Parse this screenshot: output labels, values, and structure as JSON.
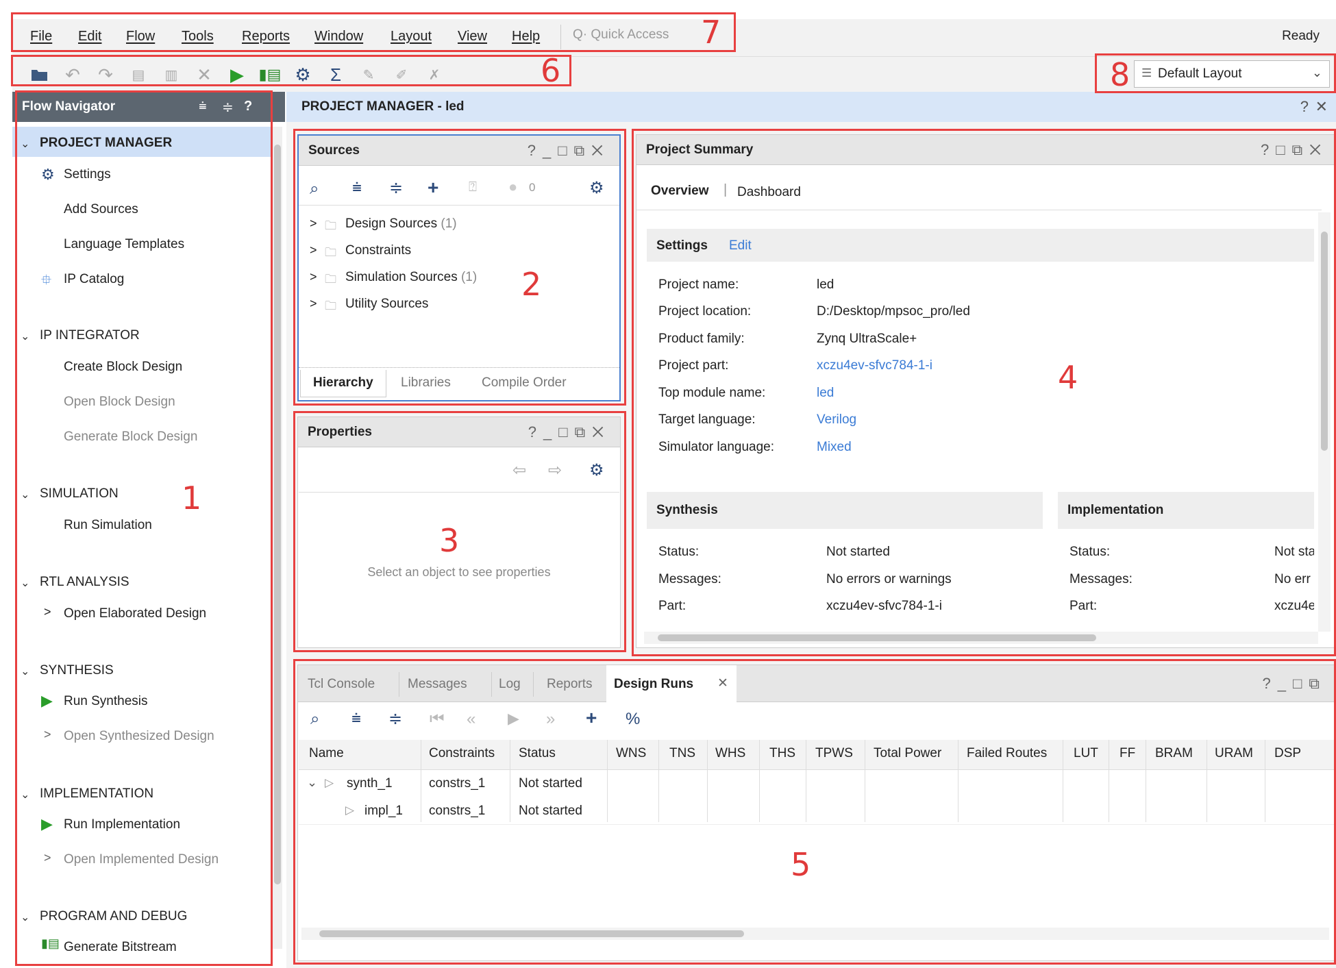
{
  "menubar": {
    "items": [
      "File",
      "Edit",
      "Flow",
      "Tools",
      "Reports",
      "Window",
      "Layout",
      "View",
      "Help"
    ],
    "quick_access": "Quick Access",
    "status": "Ready"
  },
  "layout_select": {
    "value": "Default Layout"
  },
  "annotations": [
    "1",
    "2",
    "3",
    "4",
    "5",
    "6",
    "7",
    "8"
  ],
  "flow_navigator": {
    "title": "Flow Navigator",
    "sections": [
      {
        "label": "PROJECT MANAGER",
        "items": [
          "Settings",
          "Add Sources",
          "Language Templates",
          "IP Catalog"
        ]
      },
      {
        "label": "IP INTEGRATOR",
        "items": [
          "Create Block Design",
          "Open Block Design",
          "Generate Block Design"
        ]
      },
      {
        "label": "SIMULATION",
        "items": [
          "Run Simulation"
        ]
      },
      {
        "label": "RTL ANALYSIS",
        "items": [
          "Open Elaborated Design"
        ]
      },
      {
        "label": "SYNTHESIS",
        "items": [
          "Run Synthesis",
          "Open Synthesized Design"
        ]
      },
      {
        "label": "IMPLEMENTATION",
        "items": [
          "Run Implementation",
          "Open Implemented Design"
        ]
      },
      {
        "label": "PROGRAM AND DEBUG",
        "items": [
          "Generate Bitstream"
        ]
      }
    ]
  },
  "main_header": {
    "title": "PROJECT MANAGER - led"
  },
  "sources": {
    "title": "Sources",
    "badge_count": "0",
    "tree": [
      {
        "label": "Design Sources",
        "count": "(1)"
      },
      {
        "label": "Constraints",
        "count": ""
      },
      {
        "label": "Simulation Sources",
        "count": "(1)"
      },
      {
        "label": "Utility Sources",
        "count": ""
      }
    ],
    "tabs": [
      "Hierarchy",
      "Libraries",
      "Compile Order"
    ]
  },
  "properties": {
    "title": "Properties",
    "empty_text": "Select an object to see properties"
  },
  "summary": {
    "title": "Project Summary",
    "tabs": [
      "Overview",
      "Dashboard"
    ],
    "settings_label": "Settings",
    "edit_link": "Edit",
    "rows": [
      {
        "label": "Project name:",
        "value": "led"
      },
      {
        "label": "Project location:",
        "value": "D:/Desktop/mpsoc_pro/led"
      },
      {
        "label": "Product family:",
        "value": "Zynq UltraScale+"
      },
      {
        "label": "Project part:",
        "value": "xczu4ev-sfvc784-1-i"
      },
      {
        "label": "Top module name:",
        "value": "led"
      },
      {
        "label": "Target language:",
        "value": "Verilog"
      },
      {
        "label": "Simulator language:",
        "value": "Mixed"
      }
    ],
    "synthesis": {
      "title": "Synthesis",
      "rows": [
        {
          "label": "Status:",
          "value": "Not started"
        },
        {
          "label": "Messages:",
          "value": "No errors or warnings"
        },
        {
          "label": "Part:",
          "value": "xczu4ev-sfvc784-1-i"
        }
      ]
    },
    "implementation": {
      "title": "Implementation",
      "rows": [
        {
          "label": "Status:",
          "value": "Not sta"
        },
        {
          "label": "Messages:",
          "value": "No err"
        },
        {
          "label": "Part:",
          "value": "xczu4e"
        }
      ]
    }
  },
  "bottom": {
    "tabs": [
      "Tcl Console",
      "Messages",
      "Log",
      "Reports",
      "Design Runs"
    ],
    "columns": [
      "Name",
      "Constraints",
      "Status",
      "WNS",
      "TNS",
      "WHS",
      "THS",
      "TPWS",
      "Total Power",
      "Failed Routes",
      "LUT",
      "FF",
      "BRAM",
      "URAM",
      "DSP"
    ],
    "runs": [
      {
        "name": "synth_1",
        "constraints": "constrs_1",
        "status": "Not started"
      },
      {
        "name": "impl_1",
        "constraints": "constrs_1",
        "status": "Not started"
      }
    ]
  }
}
